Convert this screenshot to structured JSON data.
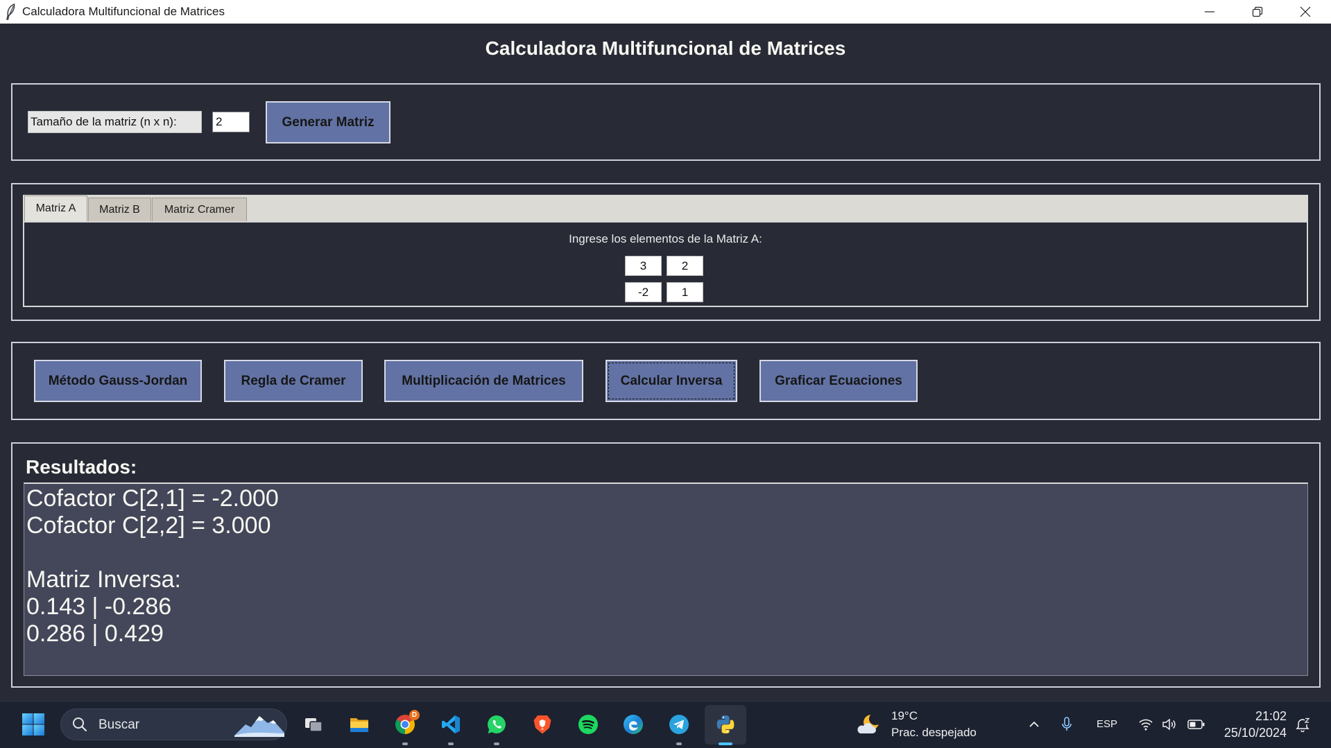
{
  "window": {
    "title": "Calculadora Multifuncional de Matrices",
    "app_icon": "feather-icon",
    "controls": [
      "minimize-icon",
      "restore-icon",
      "close-icon"
    ]
  },
  "heading": "Calculadora Multifuncional de Matrices",
  "size_panel": {
    "label": "Tamaño de la matriz (n x n):",
    "value": "2",
    "generate_button": "Generar Matriz"
  },
  "tabs": [
    {
      "label": "Matriz A"
    },
    {
      "label": "Matriz B"
    },
    {
      "label": "Matriz Cramer"
    }
  ],
  "matrix_panel": {
    "prompt": "Ingrese los elementos de la Matriz A:",
    "cells": [
      [
        "3",
        "2"
      ],
      [
        "-2",
        "1"
      ]
    ]
  },
  "actions": {
    "gauss_jordan": "Método Gauss-Jordan",
    "cramer": "Regla de Cramer",
    "multiply": "Multiplicación de Matrices",
    "inverse": "Calcular Inversa",
    "plot": "Graficar Ecuaciones"
  },
  "results": {
    "label": "Resultados:",
    "lines": [
      "Cofactor C[2,1] = -2.000",
      "Cofactor C[2,2] = 3.000",
      "",
      "Matriz Inversa:",
      "0.143 | -0.286",
      "0.286 | 0.429"
    ]
  },
  "taskbar": {
    "start_icon": "windows-start-icon",
    "search": {
      "placeholder": "Buscar",
      "icon": "search-icon"
    },
    "pinned_icons": [
      "task-view-icon",
      "file-explorer-icon",
      "chrome-icon",
      "vscode-icon",
      "whatsapp-icon",
      "brave-icon",
      "spotify-icon",
      "edge-icon",
      "telegram-icon",
      "python-icon"
    ],
    "chrome_badge": "D",
    "weather": {
      "temperature": "19°C",
      "condition": "Prac. despejado",
      "icon": "weather-moon-cloud-icon"
    },
    "tray_icons": [
      "chevron-up-icon",
      "microphone-icon",
      "wifi-icon",
      "volume-icon",
      "battery-icon",
      "notification-icon"
    ],
    "language": "ESP",
    "clock": {
      "time": "21:02",
      "date": "25/10/2024"
    }
  },
  "colors": {
    "app_bg": "#282a36",
    "button_bg": "#6272a4",
    "results_bg": "#44475a",
    "taskbar_bg": "#1c2230",
    "title_bar_bg": "#ffffff",
    "tab_strip_bg": "#dcdad5"
  }
}
